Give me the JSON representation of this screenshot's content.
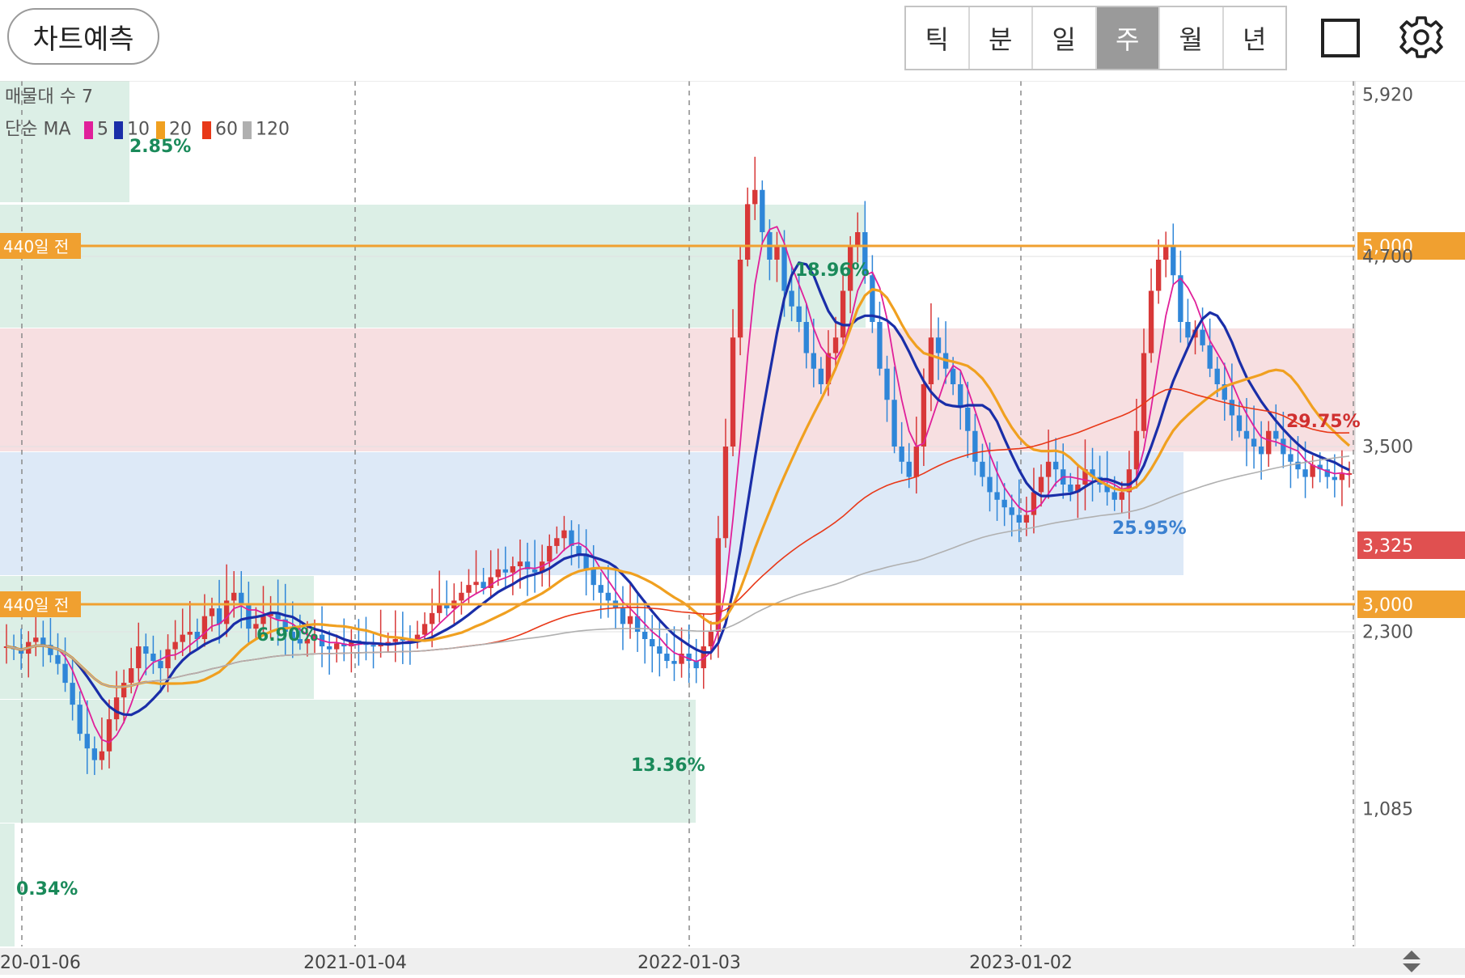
{
  "toolbar": {
    "predict_label": "차트예측",
    "periods": [
      "틱",
      "분",
      "일",
      "주",
      "월",
      "년"
    ],
    "active_period": "주",
    "layout_icon": "square-icon",
    "settings_icon": "gear-icon"
  },
  "chart_data": {
    "type": "candlestick",
    "legend": {
      "volume_profile": "매물대 수 7",
      "ma_title": "단순 MA",
      "ma_entries": [
        {
          "label": "5",
          "color": "#e0209a"
        },
        {
          "label": "10",
          "color": "#1a2ea8"
        },
        {
          "label": "20",
          "color": "#f0a020"
        },
        {
          "label": "60",
          "color": "#e83818"
        },
        {
          "label": "120",
          "color": "#b0b0b0"
        }
      ]
    },
    "y_ticks": [
      "5,920",
      "4,700",
      "3,500",
      "2,300",
      "1,085"
    ],
    "x_ticks": [
      "20-01-06",
      "2021-01-04",
      "2022-01-03",
      "2023-01-02"
    ],
    "price_lines": [
      {
        "value": 5000,
        "label": "5,000",
        "left_label": "440일 전",
        "color": "#f0a030"
      },
      {
        "value": 3000,
        "label": "3,000",
        "left_label": "440일 전",
        "color": "#f0a030"
      }
    ],
    "current_price": {
      "value": 3325,
      "label": "3,325",
      "color": "#e05050"
    },
    "zone_labels": [
      {
        "text": "2.85%",
        "color": "#1a8a5a"
      },
      {
        "text": "18.96%",
        "color": "#1a8a5a"
      },
      {
        "text": "6.90%",
        "color": "#1a8a5a"
      },
      {
        "text": "13.36%",
        "color": "#1a8a5a"
      },
      {
        "text": "0.34%",
        "color": "#1a8a5a"
      },
      {
        "text": "29.75%",
        "color": "#d03030"
      },
      {
        "text": "25.95%",
        "color": "#3a80d0"
      }
    ],
    "close": [
      2200,
      2180,
      2150,
      2230,
      2260,
      2210,
      2140,
      2080,
      1950,
      1800,
      1600,
      1500,
      1420,
      1480,
      1700,
      1850,
      1950,
      2050,
      2200,
      2150,
      2100,
      2050,
      2180,
      2230,
      2280,
      2300,
      2250,
      2400,
      2450,
      2350,
      2500,
      2550,
      2480,
      2320,
      2350,
      2400,
      2420,
      2380,
      2300,
      2250,
      2220,
      2250,
      2280,
      2200,
      2180,
      2220,
      2200,
      2240,
      2230,
      2210,
      2200,
      2220,
      2230,
      2250,
      2240,
      2230,
      2280,
      2350,
      2420,
      2480,
      2450,
      2500,
      2550,
      2600,
      2620,
      2580,
      2650,
      2700,
      2680,
      2720,
      2750,
      2700,
      2680,
      2750,
      2850,
      2900,
      2950,
      2850,
      2800,
      2700,
      2600,
      2550,
      2500,
      2450,
      2350,
      2400,
      2300,
      2250,
      2200,
      2150,
      2100,
      2080,
      2150,
      2100,
      2050,
      2200,
      2300,
      2900,
      3500,
      4200,
      4700,
      5100,
      5200,
      4900,
      4700,
      4800,
      4500,
      4400,
      4300,
      4100,
      4000,
      3900,
      4100,
      4200,
      4500,
      4800,
      4900,
      4600,
      4300,
      4000,
      3800,
      3500,
      3400,
      3300,
      3500,
      3900,
      4200,
      4100,
      4000,
      3900,
      3750,
      3600,
      3400,
      3300,
      3200,
      3150,
      3100,
      3050,
      3000,
      3050,
      3200,
      3300,
      3400,
      3350,
      3250,
      3200,
      3250,
      3350,
      3300,
      3250,
      3200,
      3150,
      3200,
      3350,
      3600,
      4100,
      4500,
      4700,
      4800,
      4600,
      4300,
      4200,
      4250,
      4150,
      4000,
      3900,
      3800,
      3700,
      3600,
      3550,
      3500,
      3450,
      3600,
      3550,
      3450,
      3400,
      3350,
      3300,
      3380,
      3350,
      3300,
      3280,
      3320,
      3325
    ],
    "ma_series": [
      {
        "name": "5",
        "period": 5,
        "color": "#e0209a",
        "width": 1.8
      },
      {
        "name": "10",
        "period": 10,
        "color": "#1a2ea8",
        "width": 3.2
      },
      {
        "name": "20",
        "period": 20,
        "color": "#f0a020",
        "width": 3.2
      },
      {
        "name": "60",
        "period": 60,
        "color": "#e83818",
        "width": 1.6
      },
      {
        "name": "120",
        "period": 120,
        "color": "#b0b0b0",
        "width": 1.6
      }
    ]
  }
}
